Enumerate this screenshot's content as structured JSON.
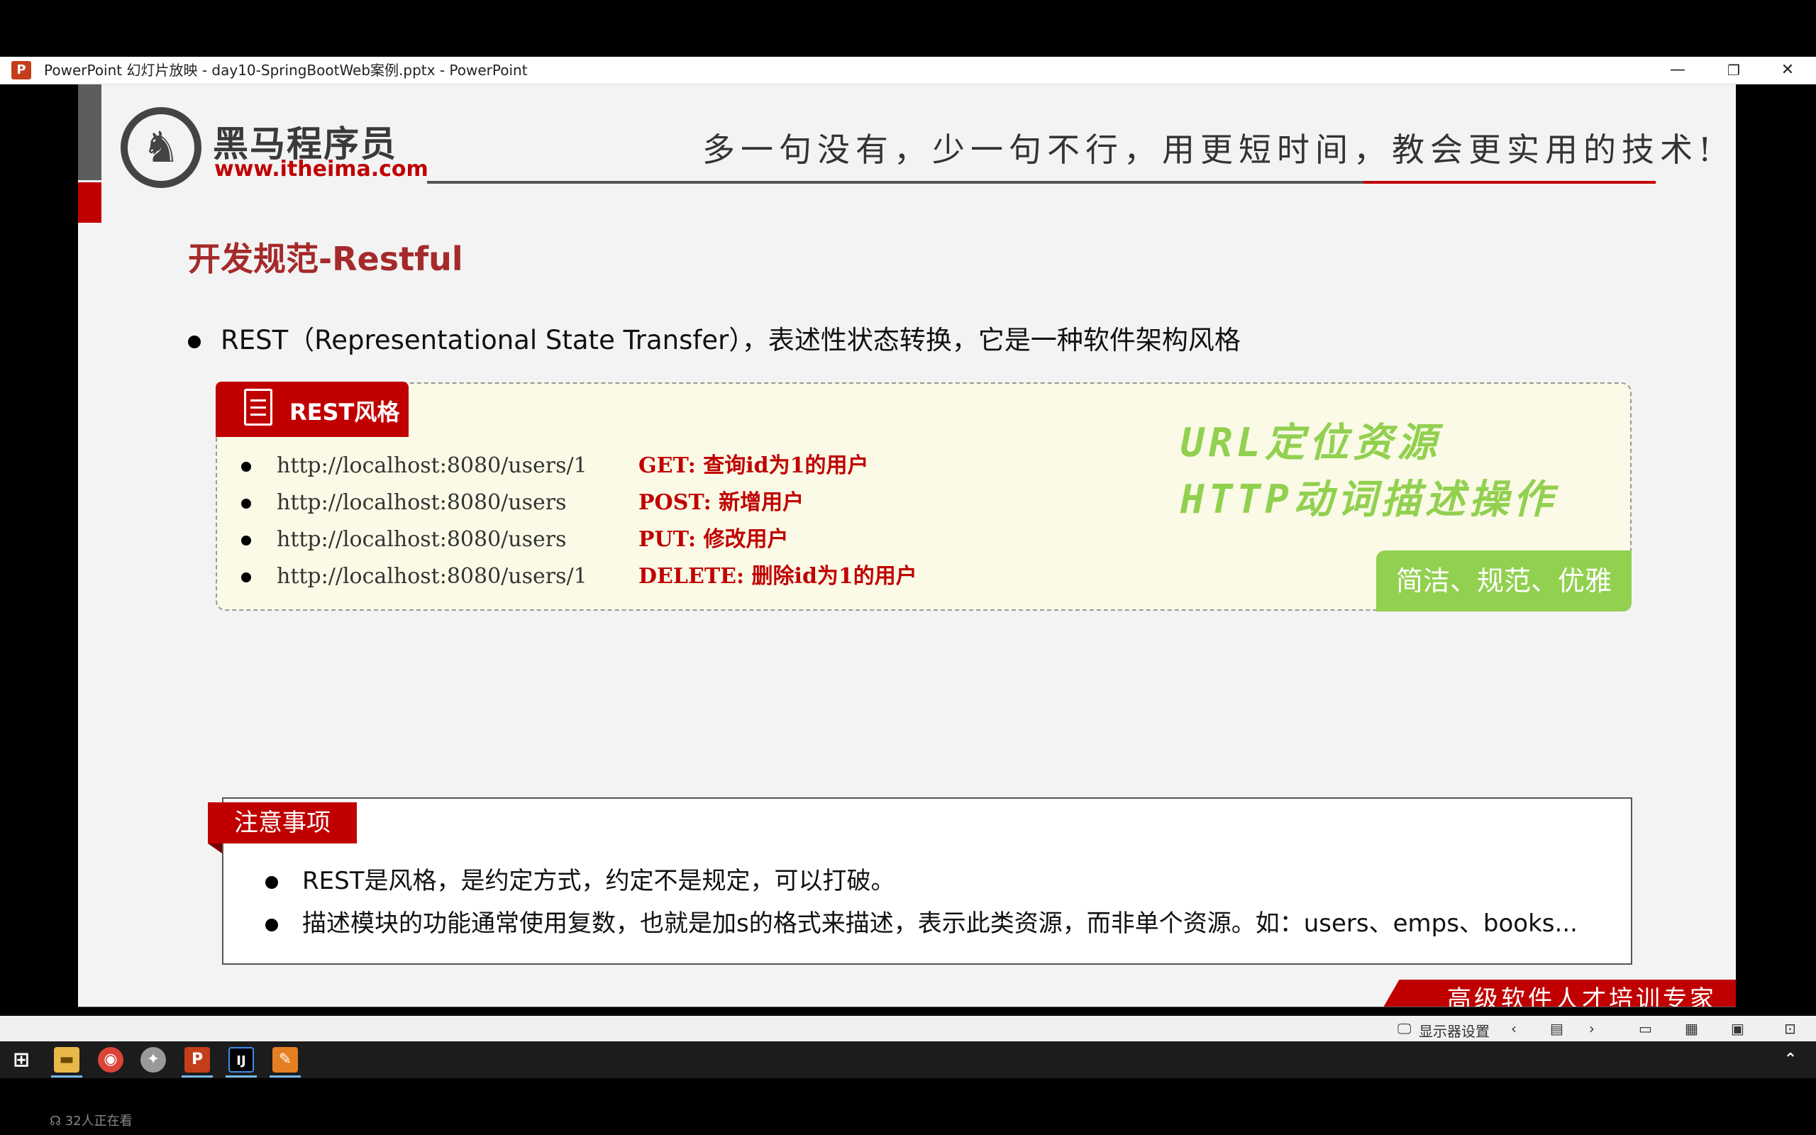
{
  "window": {
    "title": "PowerPoint 幻灯片放映  -  day10-SpringBootWeb案例.pptx - PowerPoint",
    "minimize": "—",
    "restore": "❐",
    "close": "✕"
  },
  "slide": {
    "logo_cn": "黑马程序员",
    "logo_url": "www.itheima.com",
    "slogan": "多一句没有，少一句不行，用更短时间，教会更实用的技术!",
    "heading": "开发规范-Restful",
    "main_bullet": "REST（Representational State Transfer），表述性状态转换，它是一种软件架构风格",
    "rest_box": {
      "tab_label": "REST风格",
      "rows": [
        {
          "url": "http://localhost:8080/users/1",
          "desc": "GET: 查询id为1的用户"
        },
        {
          "url": "http://localhost:8080/users",
          "desc": "POST: 新增用户"
        },
        {
          "url": "http://localhost:8080/users",
          "desc": "PUT: 修改用户"
        },
        {
          "url": "http://localhost:8080/users/1",
          "desc": "DELETE: 删除id为1的用户"
        }
      ],
      "handwritten_1": "URL定位资源",
      "handwritten_2": "HTTP动词描述操作",
      "badge": "简洁、规范、优雅"
    },
    "note": {
      "tab_label": "注意事项",
      "items": [
        "REST是风格，是约定方式，约定不是规定，可以打破。",
        "描述模块的功能通常使用复数，也就是加s的格式来描述，表示此类资源，而非单个资源。如：users、emps、books..."
      ]
    },
    "footer_text": "高级软件人才培训专家"
  },
  "statusbar": {
    "display_settings": "显示器设置"
  },
  "viewers": "32人正在看",
  "colors": {
    "accent_red": "#c00000",
    "green": "#92d050"
  }
}
